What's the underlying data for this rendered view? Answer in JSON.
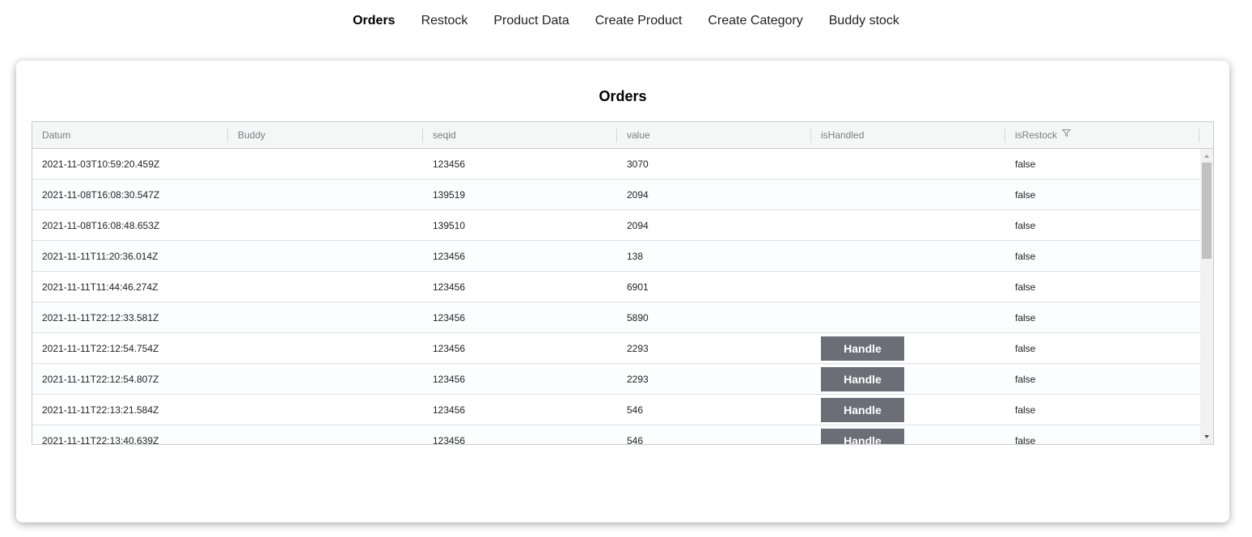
{
  "nav": {
    "items": [
      {
        "label": "Orders",
        "active": true
      },
      {
        "label": "Restock",
        "active": false
      },
      {
        "label": "Product Data",
        "active": false
      },
      {
        "label": "Create Product",
        "active": false
      },
      {
        "label": "Create Category",
        "active": false
      },
      {
        "label": "Buddy stock",
        "active": false
      }
    ]
  },
  "card": {
    "title": "Orders"
  },
  "grid": {
    "columns": [
      "Datum",
      "Buddy",
      "seqid",
      "value",
      "isHandled",
      "isRestock"
    ],
    "filter_column": "isRestock",
    "handle_label": "Handle",
    "rows": [
      {
        "datum": "2021-11-03T10:59:20.459Z",
        "buddy": "",
        "seqid": "123456",
        "value": "3070",
        "handled_button": false,
        "isRestock": "false"
      },
      {
        "datum": "2021-11-08T16:08:30.547Z",
        "buddy": "",
        "seqid": "139519",
        "value": "2094",
        "handled_button": false,
        "isRestock": "false"
      },
      {
        "datum": "2021-11-08T16:08:48.653Z",
        "buddy": "",
        "seqid": "139510",
        "value": "2094",
        "handled_button": false,
        "isRestock": "false"
      },
      {
        "datum": "2021-11-11T11:20:36.014Z",
        "buddy": "",
        "seqid": "123456",
        "value": "138",
        "handled_button": false,
        "isRestock": "false"
      },
      {
        "datum": "2021-11-11T11:44:46.274Z",
        "buddy": "",
        "seqid": "123456",
        "value": "6901",
        "handled_button": false,
        "isRestock": "false"
      },
      {
        "datum": "2021-11-11T22:12:33.581Z",
        "buddy": "",
        "seqid": "123456",
        "value": "5890",
        "handled_button": false,
        "isRestock": "false"
      },
      {
        "datum": "2021-11-11T22:12:54.754Z",
        "buddy": "",
        "seqid": "123456",
        "value": "2293",
        "handled_button": true,
        "isRestock": "false"
      },
      {
        "datum": "2021-11-11T22:12:54.807Z",
        "buddy": "",
        "seqid": "123456",
        "value": "2293",
        "handled_button": true,
        "isRestock": "false"
      },
      {
        "datum": "2021-11-11T22:13:21.584Z",
        "buddy": "",
        "seqid": "123456",
        "value": "546",
        "handled_button": true,
        "isRestock": "false"
      },
      {
        "datum": "2021-11-11T22:13:40.639Z",
        "buddy": "",
        "seqid": "123456",
        "value": "546",
        "handled_button": true,
        "isRestock": "false"
      }
    ]
  },
  "icons": {
    "filter": "filter-icon",
    "scroll_up": "chevron-up-icon",
    "scroll_down": "chevron-down-icon"
  },
  "colors": {
    "button_bg": "#6b6e76",
    "header_bg": "#f5f7f7",
    "grid_border": "#c8cccc"
  }
}
